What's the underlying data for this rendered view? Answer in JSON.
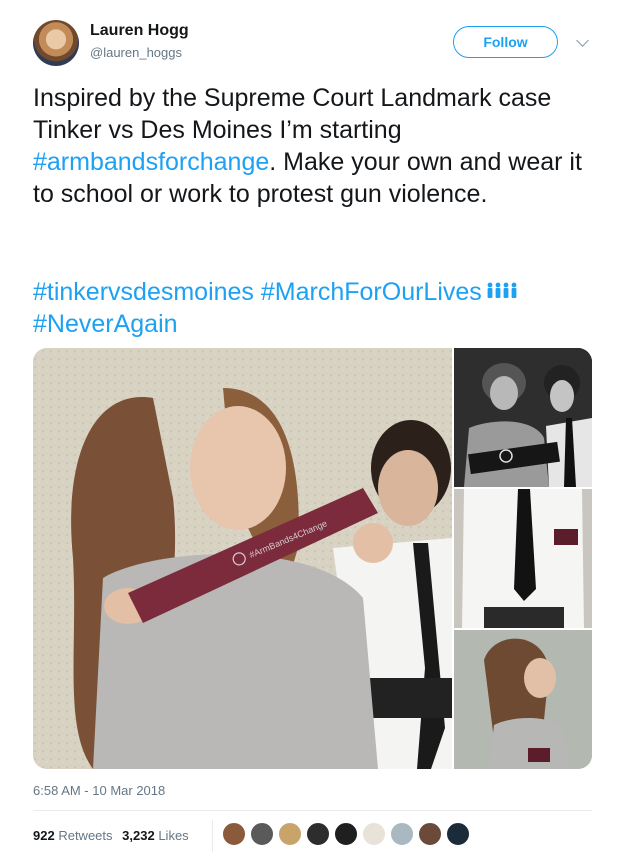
{
  "user": {
    "name": "Lauren Hogg",
    "handle": "@lauren_hoggs",
    "follow_label": "Follow"
  },
  "tweet": {
    "text_part1": "Inspired by the Supreme Court Landmark case Tinker vs Des Moines I’m starting ",
    "hashtag1": "#armbandsforchange",
    "text_part2": ". Make your own and wear it to school or work to protest gun violence.",
    "hashtag2": "#tinkervsdesmoines",
    "hashtag3": "#MarchForOurLives",
    "hashtag4": "#NeverAgain",
    "armband_text": "#ArmBands4Change"
  },
  "footer": {
    "timestamp": "6:58 AM - 10 Mar 2018",
    "retweets_count": "922",
    "retweets_label": "Retweets",
    "likes_count": "3,232",
    "likes_label": "Likes"
  },
  "likers": [
    {
      "color": "#8a5a3b"
    },
    {
      "color": "#5a5a5a"
    },
    {
      "color": "#c9a46a"
    },
    {
      "color": "#2d2d2d"
    },
    {
      "color": "#1f1f1f"
    },
    {
      "color": "#e8e2d8"
    },
    {
      "color": "#aab8c2"
    },
    {
      "color": "#6b4a3a"
    },
    {
      "color": "#1c2b3a"
    }
  ],
  "colors": {
    "accent": "#1da1f2",
    "text": "#14171a",
    "muted": "#657786"
  },
  "icons": [
    "caret-down-icon",
    "family-emoji-icon"
  ]
}
